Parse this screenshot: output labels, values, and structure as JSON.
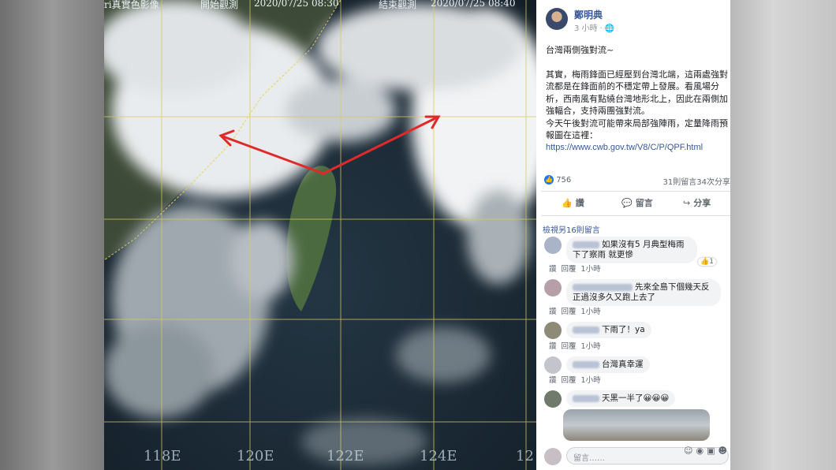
{
  "satellite": {
    "header_left": "ri真實色影像",
    "header_start_label": "開始觀測",
    "header_start_time": "2020/07/25 08:30",
    "header_end_label": "結束觀測",
    "header_end_time": "2020/07/25 08:40",
    "longitude_labels": [
      "118E",
      "120E",
      "122E",
      "124E",
      "12"
    ]
  },
  "post": {
    "author": "鄭明典",
    "time": "3 小時",
    "paragraph1": "台灣兩側強對流~",
    "paragraph2": "其實，梅雨鋒面已經壓到台灣北端，這兩處強對流都是在鋒面前的不穩定帶上發展。看風場分析，西南風有點繞台灣地形北上，因此在兩側加強輻合，支持兩團強對流。",
    "paragraph3": "今天午後對流可能帶來局部強陣雨，定量降雨預報圖在這裡：",
    "link": "https://www.cwb.gov.tw/V8/C/P/QPF.html",
    "like_count": "756",
    "comment_share_stats": "31則留言34次分享",
    "actions": {
      "like": "讚",
      "comment": "留言",
      "share": "分享"
    },
    "view_more": "檢視另16則留言",
    "comments": [
      {
        "text": "如果沒有5 月典型梅雨下了察雨 就更慘",
        "reply": "回覆",
        "like": "讚",
        "time": "1小時",
        "reactions": "1"
      },
      {
        "text": "先來全島下個幾天反正過沒多久又跑上去了",
        "reply": "回覆",
        "like": "讚",
        "time": "1小時"
      },
      {
        "text": "下雨了！ya",
        "reply": "回覆",
        "like": "讚",
        "time": "1小時"
      },
      {
        "text": "台灣真幸運",
        "reply": "回覆",
        "like": "讚",
        "time": "1小時"
      },
      {
        "text": "天黑一半了😀😀😀"
      }
    ],
    "reply_placeholder": "留言……"
  }
}
